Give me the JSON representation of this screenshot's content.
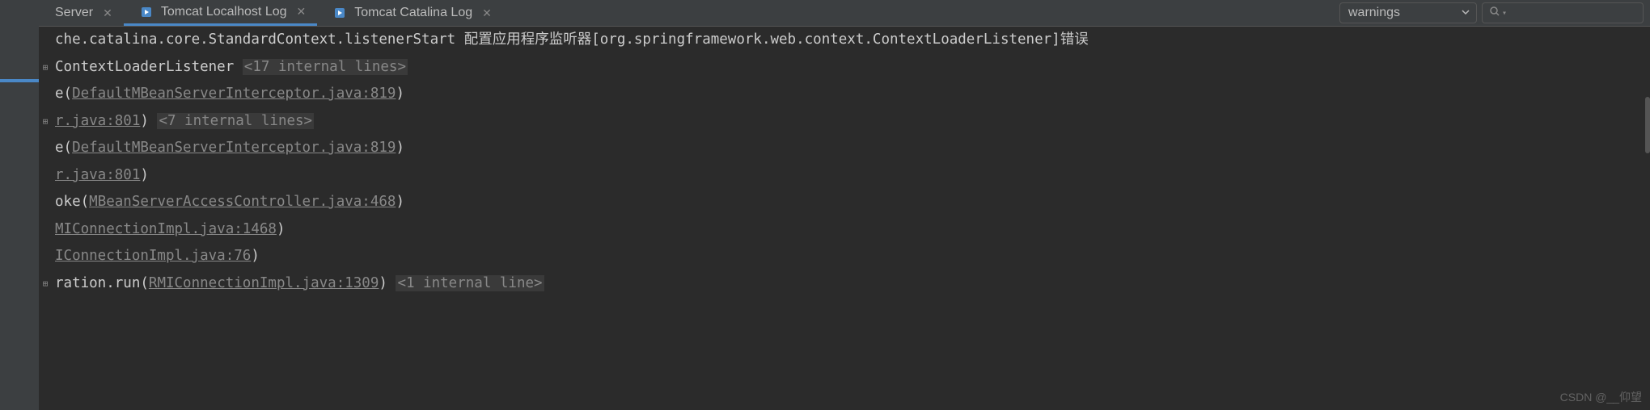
{
  "tabs": [
    {
      "label": "Server",
      "hasIcon": false
    },
    {
      "label": "Tomcat Localhost Log",
      "hasIcon": true
    },
    {
      "label": "Tomcat Catalina Log",
      "hasIcon": true
    }
  ],
  "activeTab": 1,
  "filter": {
    "selected": "warnings",
    "searchPlaceholder": ""
  },
  "log": {
    "line1_pre": "che.catalina.core.StandardContext.listenerStart 配置应用程序监听器[org.springframework.web.context.ContextLoaderListener]错误",
    "line2_a": "ContextLoaderListener ",
    "line2_dim": "<17 internal lines>",
    "line3_a": "e(",
    "line3_link": "DefaultMBeanServerInterceptor.java:819",
    "line3_b": ")",
    "line4_link": "r.java:801",
    "line4_a": ") ",
    "line4_dim": "<7 internal lines>",
    "line5_a": "e(",
    "line5_link": "DefaultMBeanServerInterceptor.java:819",
    "line5_b": ")",
    "line6_link": "r.java:801",
    "line6_a": ")",
    "line7_a": "oke(",
    "line7_link": "MBeanServerAccessController.java:468",
    "line7_b": ")",
    "line8_link": "MIConnectionImpl.java:1468",
    "line8_a": ")",
    "line9_link": "IConnectionImpl.java:76",
    "line9_a": ")",
    "line10_a": "ration.run(",
    "line10_link": "RMIConnectionImpl.java:1309",
    "line10_b": ") ",
    "line10_dim": "<1 internal line>"
  },
  "watermark": "CSDN @__仰望"
}
